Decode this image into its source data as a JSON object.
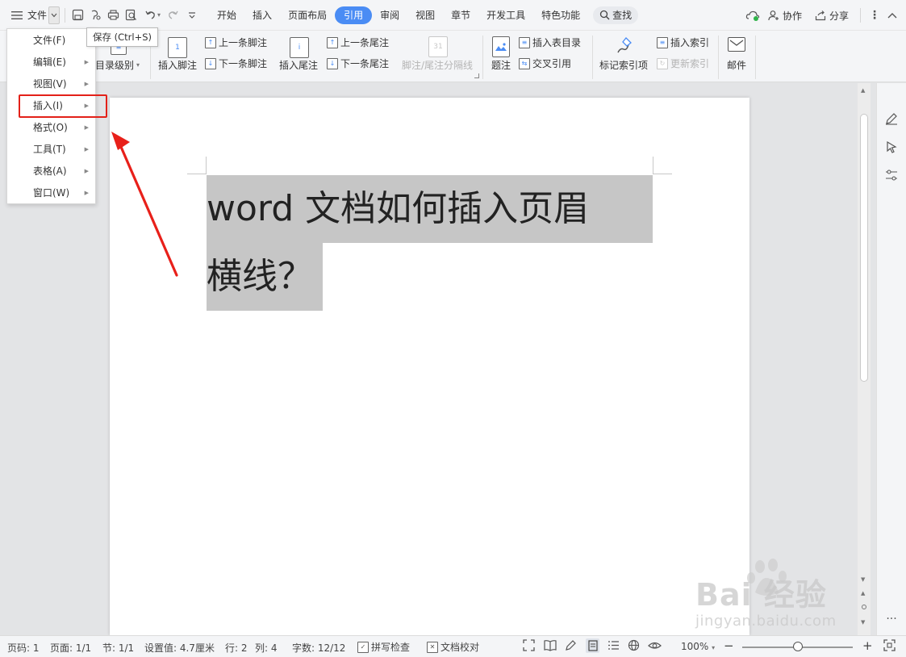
{
  "topbar": {
    "file_label": "文件",
    "tooltip": "保存 (Ctrl+S)",
    "tabs": [
      "开始",
      "插入",
      "页面布局",
      "引用",
      "审阅",
      "视图",
      "章节",
      "开发工具",
      "特色功能"
    ],
    "active_tab": "引用",
    "search_label": "查找",
    "collab_label": "协作",
    "share_label": "分享"
  },
  "ribbon": {
    "toc_level": "目录级别",
    "insert_footnote": "插入脚注",
    "prev_footnote": "上一条脚注",
    "next_footnote": "下一条脚注",
    "insert_endnote": "插入尾注",
    "prev_endnote": "上一条尾注",
    "next_endnote": "下一条尾注",
    "separator_line": "脚注/尾注分隔线",
    "caption": "题注",
    "insert_table_of_figures": "插入表目录",
    "cross_reference": "交叉引用",
    "mark_index_entry": "标记索引项",
    "insert_index": "插入索引",
    "update_index": "更新索引",
    "mail": "邮件"
  },
  "menu": {
    "items": [
      {
        "label": "文件(F)",
        "has_arrow": false
      },
      {
        "label": "编辑(E)",
        "has_arrow": true
      },
      {
        "label": "视图(V)",
        "has_arrow": true
      },
      {
        "label": "插入(I)",
        "has_arrow": true,
        "highlighted": true
      },
      {
        "label": "格式(O)",
        "has_arrow": true
      },
      {
        "label": "工具(T)",
        "has_arrow": true
      },
      {
        "label": "表格(A)",
        "has_arrow": true
      },
      {
        "label": "窗口(W)",
        "has_arrow": true
      }
    ]
  },
  "document": {
    "line1": "word 文档如何插入页眉",
    "line2": "横线？"
  },
  "statusbar": {
    "page_no": "页码: 1",
    "page": "页面: 1/1",
    "section": "节: 1/1",
    "setting": "设置值: 4.7厘米",
    "row": "行: 2",
    "col": "列: 4",
    "words": "字数: 12/12",
    "spell_check": "拼写检查",
    "proofread": "文档校对",
    "zoom": "100%",
    "zoom_level": 0.5
  },
  "watermark": {
    "brand": "Bai 经验",
    "url": "jingyan.baidu.com"
  },
  "colors": {
    "accent": "#4a8cf4",
    "highlight_box": "#e32119",
    "arrow": "#e8201a",
    "selection": "#c6c6c6"
  }
}
